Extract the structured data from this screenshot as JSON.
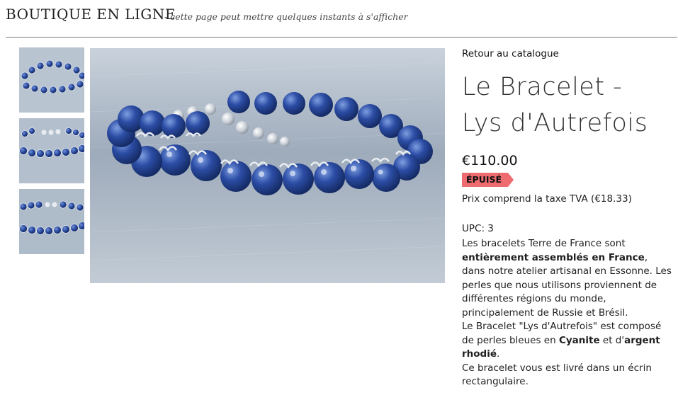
{
  "header": {
    "shop_title": "BOUTIQUE EN LIGNE",
    "subtitle": "- cette page peut mettre quelques instants à s'afficher"
  },
  "gallery": {
    "thumbnails": [
      "bracelet-photo-1",
      "bracelet-photo-2",
      "bracelet-photo-3"
    ],
    "main_image": "bracelet-photo-1"
  },
  "product": {
    "back_link": "Retour au catalogue",
    "title_line1": "Le Bracelet -",
    "title_line2": "Lys d'Autrefois",
    "price": "€110.00",
    "stock_badge": "ÉPUISÉ",
    "vat_text": "Prix comprend la taxe TVA (€18.33)",
    "upc": "UPC: 3",
    "description": {
      "p1_a": "Les bracelets Terre de France sont ",
      "p1_b": "entièrement assemblés en France",
      "p1_c": ", dans notre atelier artisanal en Essonne. Les perles que nous utilisons proviennent de différentes régions du monde, principalement de Russie et Brésil.",
      "p2_a": "Le Bracelet \"Lys d'Autrefois\" est composé de perles bleues en ",
      "p2_b": "Cyanite",
      "p2_c": " et d'",
      "p2_d": "argent rhodié",
      "p2_e": ".",
      "p3": "Ce bracelet vous est livré dans un écrin rectangulaire."
    }
  },
  "colors": {
    "badge": "#ee6b6f",
    "bead_blue": "#1f3f8f",
    "header_rule": "#7a7a7a"
  }
}
